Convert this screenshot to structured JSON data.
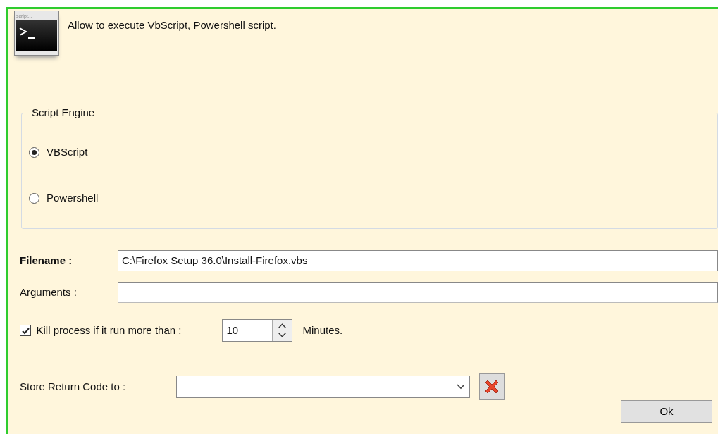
{
  "header": {
    "icon_caption": "script...",
    "description": "Allow to execute VbScript, Powershell script."
  },
  "script_engine": {
    "title": "Script Engine",
    "options": [
      {
        "label": "VBScript",
        "selected": true
      },
      {
        "label": "Powershell",
        "selected": false
      }
    ]
  },
  "filename": {
    "label": "Filename :",
    "value": "C:\\Firefox Setup 36.0\\Install-Firefox.vbs"
  },
  "arguments": {
    "label": "Arguments :"
  },
  "kill_process": {
    "checked": true,
    "label": "Kill process if it run more than :",
    "value": "10",
    "unit": "Minutes."
  },
  "store_return_code": {
    "label": "Store Return Code to :"
  },
  "ok_button": "Ok"
}
